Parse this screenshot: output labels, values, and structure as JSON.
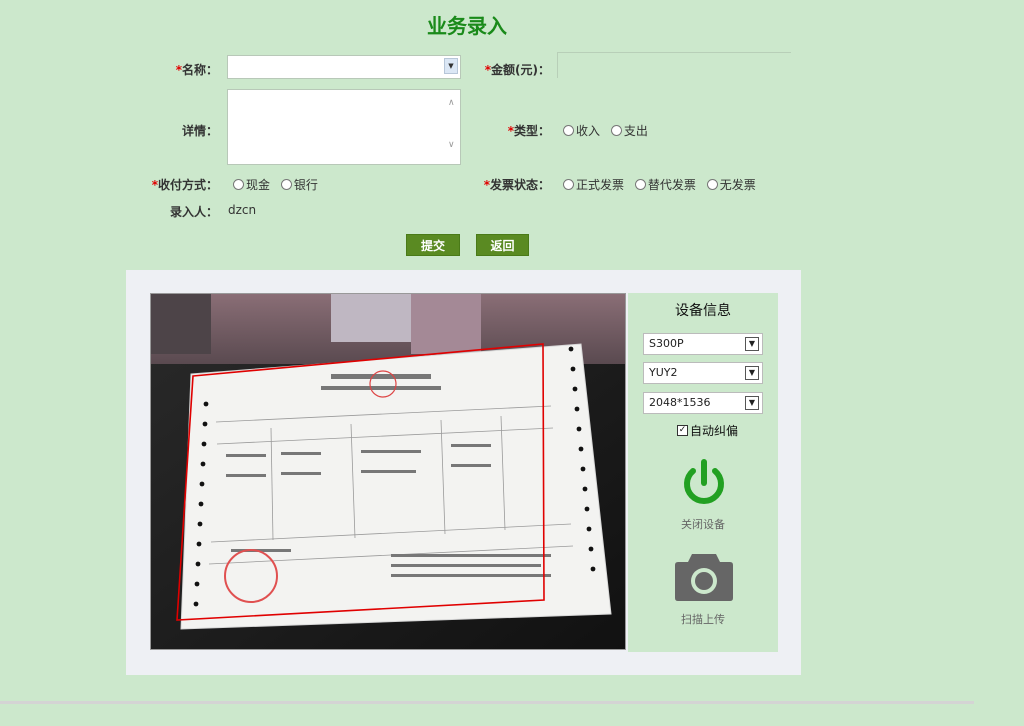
{
  "page": {
    "title": "业务录入"
  },
  "form": {
    "name": {
      "required_mark": "*",
      "label": "名称：",
      "value": ""
    },
    "amount": {
      "required_mark": "*",
      "label": "金额(元)：",
      "value": ""
    },
    "detail": {
      "label": "详情：",
      "value": ""
    },
    "type": {
      "required_mark": "*",
      "label": "类型：",
      "options": [
        "收入",
        "支出"
      ]
    },
    "payment": {
      "required_mark": "*",
      "label": "收付方式：",
      "options": [
        "现金",
        "银行"
      ]
    },
    "invoice": {
      "required_mark": "*",
      "label": "发票状态：",
      "options": [
        "正式发票",
        "替代发票",
        "无发票"
      ]
    },
    "recorder": {
      "label": "录入人：",
      "value": "dzcn"
    }
  },
  "actions": {
    "submit": "提交",
    "back": "返回"
  },
  "device": {
    "title": "设备信息",
    "model": "S300P",
    "format": "YUY2",
    "resolution": "2048*1536",
    "auto_correct": {
      "label": "自动纠偏",
      "checked": true
    },
    "power_label": "关闭设备",
    "capture_label": "扫描上传"
  },
  "colors": {
    "accent_green": "#1a8a1a",
    "button_green": "#5a8a22",
    "power_icon": "#22a022",
    "crop_frame": "#e00000"
  },
  "icons": {
    "power": "power-icon",
    "camera": "camera-icon",
    "dropdown": "chevron-down-icon"
  }
}
